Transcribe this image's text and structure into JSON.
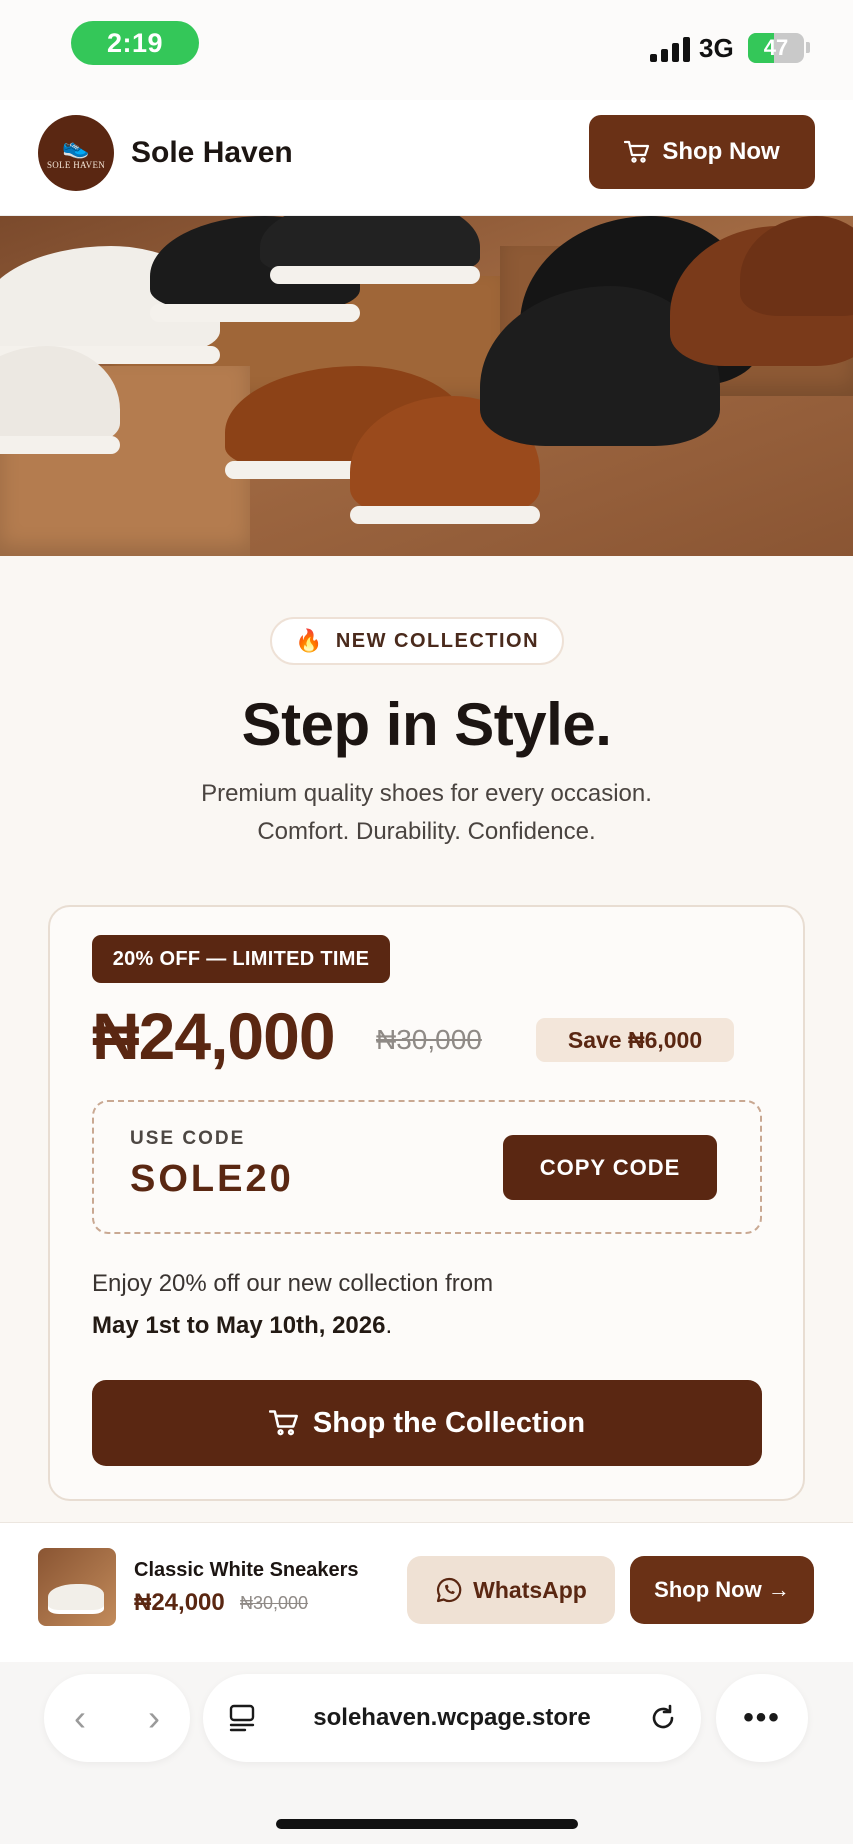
{
  "status_bar": {
    "time": "2:19",
    "network": "3G",
    "battery": "47",
    "battery_level": 0.47,
    "time_pill_color": "#34c759"
  },
  "header": {
    "brand": "Sole Haven",
    "logo_text": "SOLE HAVEN",
    "cta_label": "Shop Now",
    "cta_icon": "cart-icon"
  },
  "hero_image": {
    "subject": "shoes-display-photo"
  },
  "promo": {
    "badge_icon": "flame-icon",
    "badge": "NEW COLLECTION",
    "title": "Step in Style.",
    "subtitle_line1": "Premium quality shoes for every occasion.",
    "subtitle_line2": "Comfort. Durability. Confidence."
  },
  "offer": {
    "tag": "20% OFF — LIMITED TIME",
    "price": "₦24,000",
    "old_price": "₦30,000",
    "save": "Save ₦6,000",
    "code_label": "USE CODE",
    "code": "SOLE20",
    "copy_button": "COPY CODE",
    "description": "Enjoy 20% off our new collection from",
    "dates": "May 1st to May 10th, 2026",
    "dates_end": ".",
    "cta": "Shop the Collection"
  },
  "sticky_bar": {
    "product_name": "Classic White Sneakers",
    "price": "₦24,000",
    "old_price": "₦30,000",
    "whatsapp_label": "WhatsApp",
    "shop_label": "Shop Now →"
  },
  "browser": {
    "url": "solehaven.wcpage.store",
    "back": "‹",
    "forward": "›",
    "more": "•••"
  },
  "colors": {
    "brand_brown": "#5a2712",
    "button_brown": "#6a3116",
    "tint": "#efe1d4",
    "background": "#faf7f3"
  }
}
